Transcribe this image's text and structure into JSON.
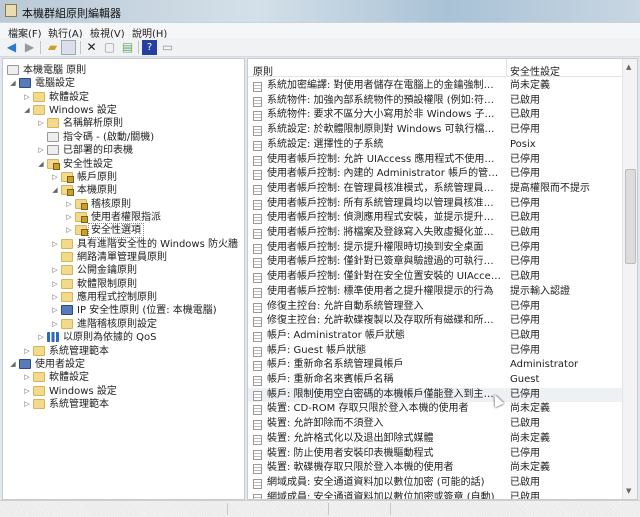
{
  "window": {
    "title": "本機群組原則編輯器"
  },
  "menu": [
    "檔案(F)",
    "執行(A)",
    "檢視(V)",
    "說明(H)"
  ],
  "toolbar": {
    "icons": [
      "back-icon",
      "forward-icon",
      "up-folder-icon",
      "show-hide-tree-icon",
      "delete-icon",
      "properties-icon",
      "export-icon",
      "help-icon",
      "console-tree-icon"
    ]
  },
  "tree": [
    {
      "label": "本機電腦 原則",
      "level": 0,
      "state": "none",
      "icon": "doc"
    },
    {
      "label": "電腦設定",
      "level": 1,
      "state": "open",
      "icon": "pc"
    },
    {
      "label": "軟體設定",
      "level": 2,
      "state": "closed",
      "icon": "folder"
    },
    {
      "label": "Windows 設定",
      "level": 2,
      "state": "open",
      "icon": "folder"
    },
    {
      "label": "名稱解析原則",
      "level": 3,
      "state": "closed",
      "icon": "folder"
    },
    {
      "label": "指令碼 - (啟動/關機)",
      "level": 3,
      "state": "none",
      "icon": "doc"
    },
    {
      "label": "已部署的印表機",
      "level": 3,
      "state": "closed",
      "icon": "doc"
    },
    {
      "label": "安全性設定",
      "level": 3,
      "state": "open",
      "icon": "lock"
    },
    {
      "label": "帳戶原則",
      "level": 4,
      "state": "closed",
      "icon": "lock"
    },
    {
      "label": "本機原則",
      "level": 4,
      "state": "open",
      "icon": "lock"
    },
    {
      "label": "稽核原則",
      "level": 5,
      "state": "closed",
      "icon": "lock"
    },
    {
      "label": "使用者權限指派",
      "level": 5,
      "state": "closed",
      "icon": "lock"
    },
    {
      "label": "安全性選項",
      "level": 5,
      "state": "closed",
      "icon": "lock",
      "selected": true
    },
    {
      "label": "具有進階安全性的 Windows 防火牆",
      "level": 4,
      "state": "closed",
      "icon": "folder"
    },
    {
      "label": "網路清單管理員原則",
      "level": 4,
      "state": "none",
      "icon": "folder"
    },
    {
      "label": "公開金鑰原則",
      "level": 4,
      "state": "closed",
      "icon": "folder"
    },
    {
      "label": "軟體限制原則",
      "level": 4,
      "state": "closed",
      "icon": "folder"
    },
    {
      "label": "應用程式控制原則",
      "level": 4,
      "state": "closed",
      "icon": "folder"
    },
    {
      "label": "IP 安全性原則 (位置: 本機電腦)",
      "level": 4,
      "state": "closed",
      "icon": "pc"
    },
    {
      "label": "進階稽核原則設定",
      "level": 4,
      "state": "closed",
      "icon": "folder"
    },
    {
      "label": "以原則為依據的 QoS",
      "level": 3,
      "state": "closed",
      "icon": "bars"
    },
    {
      "label": "系統管理範本",
      "level": 2,
      "state": "closed",
      "icon": "folder"
    },
    {
      "label": "使用者設定",
      "level": 1,
      "state": "open",
      "icon": "pc"
    },
    {
      "label": "軟體設定",
      "level": 2,
      "state": "closed",
      "icon": "folder"
    },
    {
      "label": "Windows 設定",
      "level": 2,
      "state": "closed",
      "icon": "folder"
    },
    {
      "label": "系統管理範本",
      "level": 2,
      "state": "closed",
      "icon": "folder"
    }
  ],
  "list": {
    "columns": [
      "原則",
      "安全性設定"
    ],
    "rows": [
      [
        "系統加密編譯: 對使用者儲存在電腦上的金鑰強制使用增強...",
        "尚未定義"
      ],
      [
        "系統物件: 加強內部系統物件的預設權限 (例如:符號連結)",
        "已啟用"
      ],
      [
        "系統物件: 要求不區分大小寫用於非 Windows 子系統",
        "已啟用"
      ],
      [
        "系統設定: 於軟體限制原則對 Windows 可執行檔使用憑證規...",
        "已停用"
      ],
      [
        "系統設定: 選擇性的子系統",
        "Posix"
      ],
      [
        "使用者帳戶控制: 允許 UIAccess 應用程式不使用安全桌面來...",
        "已停用"
      ],
      [
        "使用者帳戶控制: 內建的 Administrator 帳戶的管理員核准模...",
        "已停用"
      ],
      [
        "使用者帳戶控制: 在管理員核准模式，系統管理員之提升權...",
        "提高權限而不提示"
      ],
      [
        "使用者帳戶控制: 所有系統管理員均以管理員核准模式執行",
        "已停用"
      ],
      [
        "使用者帳戶控制: 偵測應用程式安裝，並提示提升權限",
        "已啟用"
      ],
      [
        "使用者帳戶控制: 將檔案及登錄寫入失敗虛擬化並儲存至每...",
        "已啟用"
      ],
      [
        "使用者帳戶控制: 提示提升權限時切換到安全桌面",
        "已停用"
      ],
      [
        "使用者帳戶控制: 僅針對已簽章與驗證過的可執行檔，提高...",
        "已停用"
      ],
      [
        "使用者帳戶控制: 僅針對在安全位置安裝的 UIAccess 應用程...",
        "已啟用"
      ],
      [
        "使用者帳戶控制: 標準使用者之提升權限提示的行為",
        "提示輸入認證"
      ],
      [
        "修復主控台: 允許自動系統管理登入",
        "已停用"
      ],
      [
        "修復主控台: 允許軟碟複製以及存取所有磁碟和所有資料夾",
        "已停用"
      ],
      [
        "帳戶: Administrator 帳戶狀態",
        "已啟用"
      ],
      [
        "帳戶: Guest 帳戶狀態",
        "已停用"
      ],
      [
        "帳戶: 重新命名系統管理員帳戶",
        "Administrator"
      ],
      [
        "帳戶: 重新命名來賓帳戶名稱",
        "Guest"
      ],
      [
        "帳戶: 限制使用空白密碼的本機帳戶僅能登入到主控台",
        "已停用"
      ],
      [
        "裝置: CD-ROM 存取只限於登入本機的使用者",
        "尚未定義"
      ],
      [
        "裝置: 允許卸除而不須登入",
        "已啟用"
      ],
      [
        "裝置: 允許格式化以及退出卸除式媒體",
        "尚未定義"
      ],
      [
        "裝置: 防止使用者安裝印表機驅動程式",
        "已停用"
      ],
      [
        "裝置: 軟碟機存取只限於登入本機的使用者",
        "尚未定義"
      ],
      [
        "網域成員: 安全通道資料加以數位加密 (可能的話)",
        "已啟用"
      ],
      [
        "網域成員: 安全通道資料加以數位加密或簽章 (自動)",
        "已啟用"
      ]
    ],
    "hover_index": 21
  }
}
